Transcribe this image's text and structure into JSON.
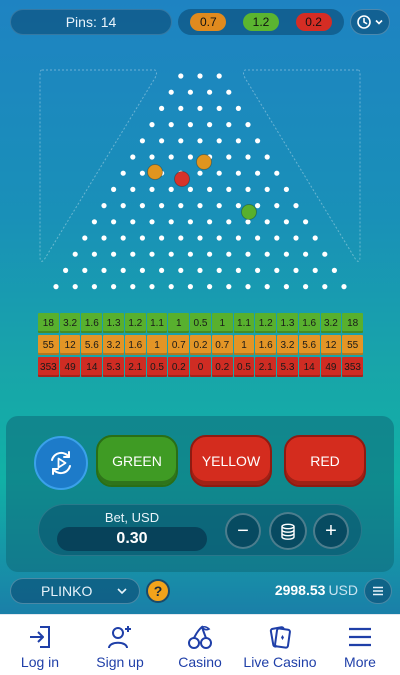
{
  "header": {
    "pins_label": "Pins: 14",
    "odds": [
      {
        "value": "0.7",
        "color": "#e08a1e"
      },
      {
        "value": "1.2",
        "color": "#5bb530"
      },
      {
        "value": "0.2",
        "color": "#d52d24"
      }
    ],
    "history_icon": "history-clock-icon"
  },
  "board": {
    "rows": 14,
    "balls": [
      {
        "color": "#e0951e"
      },
      {
        "color": "#e0951e"
      },
      {
        "color": "#d6332a"
      },
      {
        "color": "#58b02e"
      }
    ]
  },
  "multipliers": {
    "green": {
      "color": "#58b02e",
      "values": [
        "18",
        "3.2",
        "1.6",
        "1.3",
        "1.2",
        "1.1",
        "1",
        "0.5",
        "1",
        "1.1",
        "1.2",
        "1.3",
        "1.6",
        "3.2",
        "18"
      ]
    },
    "yellow": {
      "color": "#e39526",
      "values": [
        "55",
        "12",
        "5.6",
        "3.2",
        "1.6",
        "1",
        "0.7",
        "0.2",
        "0.7",
        "1",
        "1.6",
        "3.2",
        "5.6",
        "12",
        "55"
      ]
    },
    "red": {
      "color": "#cf2c23",
      "values": [
        "353",
        "49",
        "14",
        "5.3",
        "2.1",
        "0.5",
        "0.2",
        "0",
        "0.2",
        "0.5",
        "2.1",
        "5.3",
        "14",
        "49",
        "353"
      ]
    }
  },
  "controls": {
    "auto_icon": "autoplay-icon",
    "green_label": "GREEN",
    "yellow_label": "YELLOW",
    "red_label": "RED",
    "bet_label": "Bet, USD",
    "bet_value": "0.30",
    "minus_label": "−",
    "plus_label": "+",
    "chips_icon": "coin-stack-icon"
  },
  "footer": {
    "game_name": "PLINKO",
    "help_label": "?",
    "balance_amount": "2998.53",
    "balance_currency": "USD"
  },
  "bottom_nav": [
    {
      "label": "Log in",
      "icon": "login-icon"
    },
    {
      "label": "Sign up",
      "icon": "add-user-icon"
    },
    {
      "label": "Casino",
      "icon": "cherries-icon"
    },
    {
      "label": "Live Casino",
      "icon": "playing-cards-icon"
    },
    {
      "label": "More",
      "icon": "hamburger-menu-icon"
    }
  ]
}
